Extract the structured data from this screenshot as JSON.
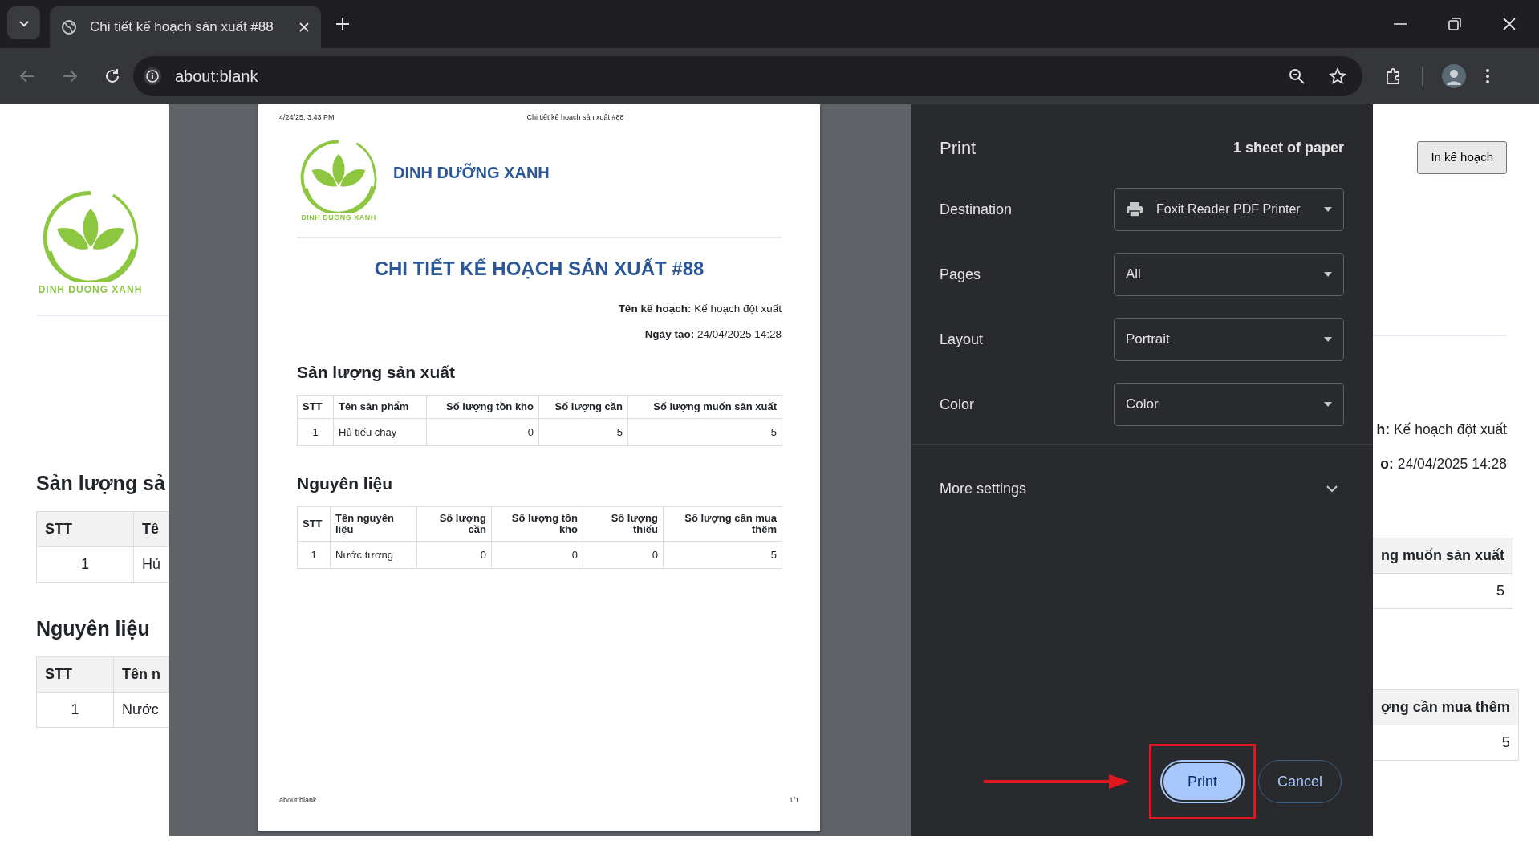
{
  "browser": {
    "tab": {
      "title": "Chi tiết kế hoạch sản xuất #88",
      "selected": true
    },
    "address": "about:blank"
  },
  "background_page": {
    "left": {
      "logo_text": "DINH DUONG XANH",
      "sections": [
        {
          "heading": "Sản lượng sả",
          "columns": [
            {
              "label": "STT",
              "kind": "index"
            },
            {
              "label": "Tê",
              "kind": "text"
            }
          ],
          "rows": [
            [
              "1",
              "Hủ"
            ]
          ]
        },
        {
          "heading": "Nguyên liệu",
          "columns": [
            {
              "label": "STT",
              "kind": "index"
            },
            {
              "label": "Tên n",
              "kind": "text"
            }
          ],
          "rows": [
            [
              "1",
              "Nước"
            ]
          ]
        }
      ]
    },
    "right": {
      "print_button": "In kế hoạch",
      "fields": [
        "**h:** Kế hoạch đột xuất",
        "**o:** 24/04/2025 14:28"
      ],
      "sections": [
        {
          "columns": [
            {
              "label": "ng muốn sản xuất",
              "kind": "number"
            }
          ],
          "rows": [
            [
              "5"
            ]
          ]
        },
        {
          "columns": [
            {
              "label": "ợng cần mua thêm",
              "kind": "number"
            }
          ],
          "rows": [
            [
              "5"
            ]
          ]
        }
      ]
    }
  },
  "print_dialog": {
    "preview": {
      "header_date": "4/24/25, 3:43 PM",
      "header_title": "Chi tiết kế hoạch sản xuất #88",
      "logo_text": "DINH DUONG XANH",
      "brand": "DINH DƯỠNG XANH",
      "title": "CHI TIẾT KẾ HOẠCH SẢN XUẤT #88",
      "fields": [
        "**Tên kế hoạch:** Kế hoạch đột xuất",
        "**Ngày tạo:** 24/04/2025 14:28"
      ],
      "sections": [
        {
          "heading": "Sản lượng sản xuất",
          "columns": [
            {
              "label": "STT",
              "kind": "index"
            },
            {
              "label": "Tên sản phẩm",
              "kind": "text"
            },
            {
              "label": "Số lượng tồn kho",
              "kind": "number"
            },
            {
              "label": "Số lượng cần",
              "kind": "number"
            },
            {
              "label": "Số lượng muốn sản xuất",
              "kind": "number"
            }
          ],
          "rows": [
            [
              "1",
              "Hủ tiếu chay",
              "0",
              "5",
              "5"
            ]
          ]
        },
        {
          "heading": "Nguyên liệu",
          "columns": [
            {
              "label": "STT",
              "kind": "index"
            },
            {
              "label": "Tên nguyên liệu",
              "kind": "text"
            },
            {
              "label": "Số lượng cần",
              "kind": "number"
            },
            {
              "label": "Số lượng tồn kho",
              "kind": "number"
            },
            {
              "label": "Số lượng thiếu",
              "kind": "number"
            },
            {
              "label": "Số lượng cần mua thêm",
              "kind": "number"
            }
          ],
          "rows": [
            [
              "1",
              "Nước tương",
              "0",
              "0",
              "0",
              "5"
            ]
          ]
        }
      ],
      "footer_url": "about:blank",
      "page_number": "1/1"
    },
    "settings": {
      "title": "Print",
      "sheets": "1 sheet of paper",
      "options": [
        {
          "label": "Destination",
          "value": "Foxit Reader PDF Printer",
          "kind": "printer"
        },
        {
          "label": "Pages",
          "value": "All",
          "kind": "plain"
        },
        {
          "label": "Layout",
          "value": "Portrait",
          "kind": "plain"
        },
        {
          "label": "Color",
          "value": "Color",
          "kind": "plain"
        }
      ],
      "more_settings": {
        "label": "More settings",
        "expanded": false
      },
      "buttons": [
        {
          "label": "Print",
          "kind": "primary",
          "highlighted": true
        },
        {
          "label": "Cancel",
          "kind": "secondary",
          "highlighted": false
        }
      ]
    }
  }
}
